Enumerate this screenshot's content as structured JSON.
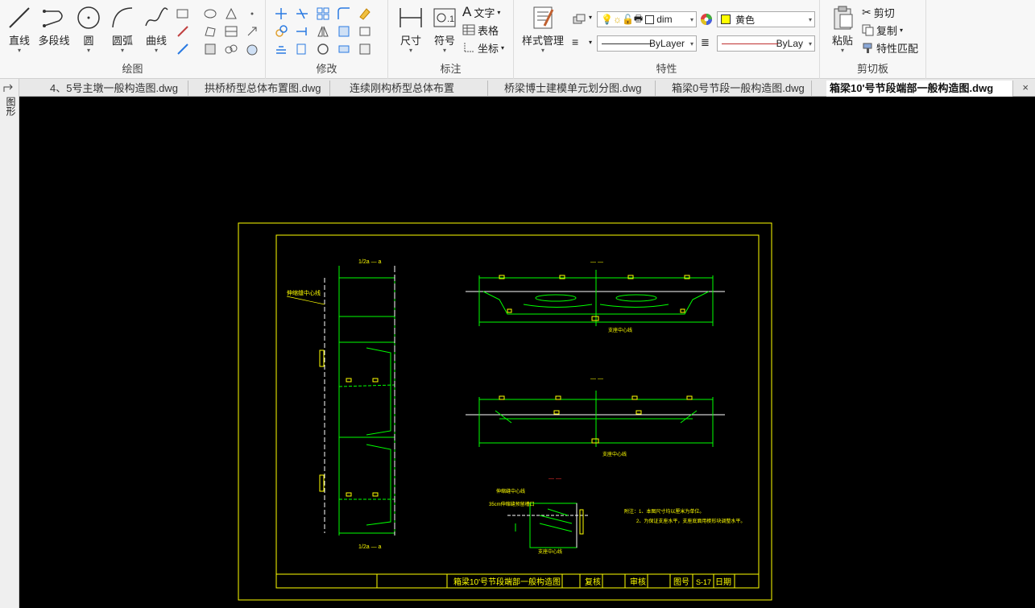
{
  "ribbon": {
    "draw": {
      "title": "绘图",
      "line": "直线",
      "polyline": "多段线",
      "circle": "圆",
      "arc": "圆弧",
      "curve": "曲线"
    },
    "modify": {
      "title": "修改"
    },
    "annotate": {
      "title": "标注",
      "dimension": "尺寸",
      "symbol": "符号",
      "text": "文字",
      "table": "表格",
      "coord": "坐标"
    },
    "properties": {
      "title": "特性",
      "style_manager": "样式管理",
      "layer": "dim",
      "color": "黄色",
      "linetype": "ByLayer",
      "lineweight": "ByLay",
      "color_hex": "#ffff00"
    },
    "clipboard": {
      "title": "剪切板",
      "paste": "粘贴",
      "cut": "剪切",
      "copy": "复制",
      "match": "特性匹配"
    }
  },
  "tabs": [
    {
      "label": "4、5号主墩一般构造图.dwg",
      "active": false
    },
    {
      "label": "拱桥桥型总体布置图.dwg",
      "active": false
    },
    {
      "label": "连续刚构桥型总体布置",
      "active": false
    },
    {
      "label": "桥梁博士建模单元划分图.dwg",
      "active": false
    },
    {
      "label": "箱梁0号节段一般构造图.dwg",
      "active": false
    },
    {
      "label": "箱梁10'号节段端部一般构造图.dwg",
      "active": true
    }
  ],
  "sidebar": {
    "label": "图形"
  },
  "drawing": {
    "top_view_label": "1/2a — a",
    "bottom_view_label": "1/2a — a",
    "left_note": "伸缩缝中心线",
    "section_top_label": "— —",
    "section_mid_label": "— —",
    "section_small_label": "— —",
    "bearing_label_1": "支座中心线",
    "bearing_label_2": "支座中心线",
    "bearing_label_3": "支座中心线",
    "expansion_note": "伸缩缝中心线",
    "anchor_note": "35cm伸缩缝预留槽口",
    "notes_1": "附注：1、本图尺寸均以厘米为单位。",
    "notes_2": "2、为保证支座水平，支座底面用楔形块调整水平。",
    "title_block_name": "箱梁10'号节段端部一般构造图",
    "tb_review": "复核",
    "tb_audit": "审核",
    "tb_drawing_no": "图号",
    "tb_no_value": "S-17",
    "tb_date": "日期"
  }
}
